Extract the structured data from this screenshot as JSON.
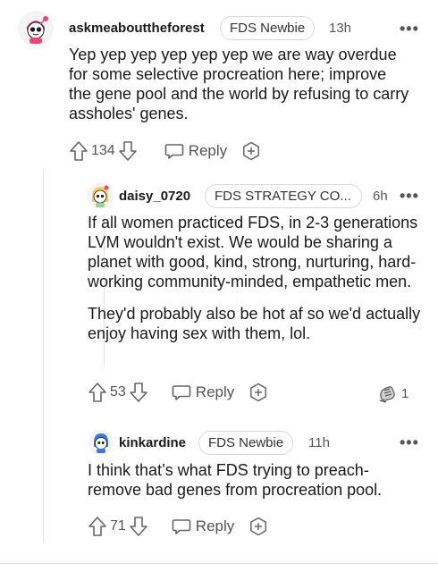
{
  "comments": [
    {
      "username": "askmeabouttheforest",
      "flair": "FDS Newbie",
      "time": "13h",
      "body": [
        "Yep yep yep yep yep yep we are way overdue for some selective procreation here; improve the gene pool and the world by refusing to carry assholes' genes."
      ],
      "votes": "134",
      "reply_label": "Reply",
      "avatar_icon": "snoo-pink-avatar-icon"
    },
    {
      "username": "daisy_0720",
      "flair": "FDS STRATEGY CO...",
      "time": "6h",
      "body": [
        "If all women practiced FDS, in 2-3 generations LVM wouldn't exist. We would be sharing a planet with good, kind, strong, nurturing, hard-working community-minded, empathetic men.",
        "They'd probably also be hot af so we'd actually enjoy having sex with them, lol."
      ],
      "votes": "53",
      "reply_label": "Reply",
      "award_count": "1",
      "avatar_icon": "snoo-blonde-avatar-icon"
    },
    {
      "username": "kinkardine",
      "flair": "FDS Newbie",
      "time": "11h",
      "body": [
        "I think that’s what FDS trying to preach-remove bad genes from procreation pool."
      ],
      "votes": "71",
      "reply_label": "Reply",
      "avatar_icon": "snoo-blue-avatar-icon"
    }
  ],
  "icons": {
    "upvote": "upvote-arrow-icon",
    "downvote": "downvote-arrow-icon",
    "reply": "speech-bubble-icon",
    "award": "add-award-icon",
    "more": "more-options-icon",
    "received_award": "hand-award-icon"
  },
  "colors": {
    "text": "#1a1a1b",
    "meta": "#555555",
    "border": "#d8d8d8",
    "avatar_pink": "#e8457a"
  }
}
